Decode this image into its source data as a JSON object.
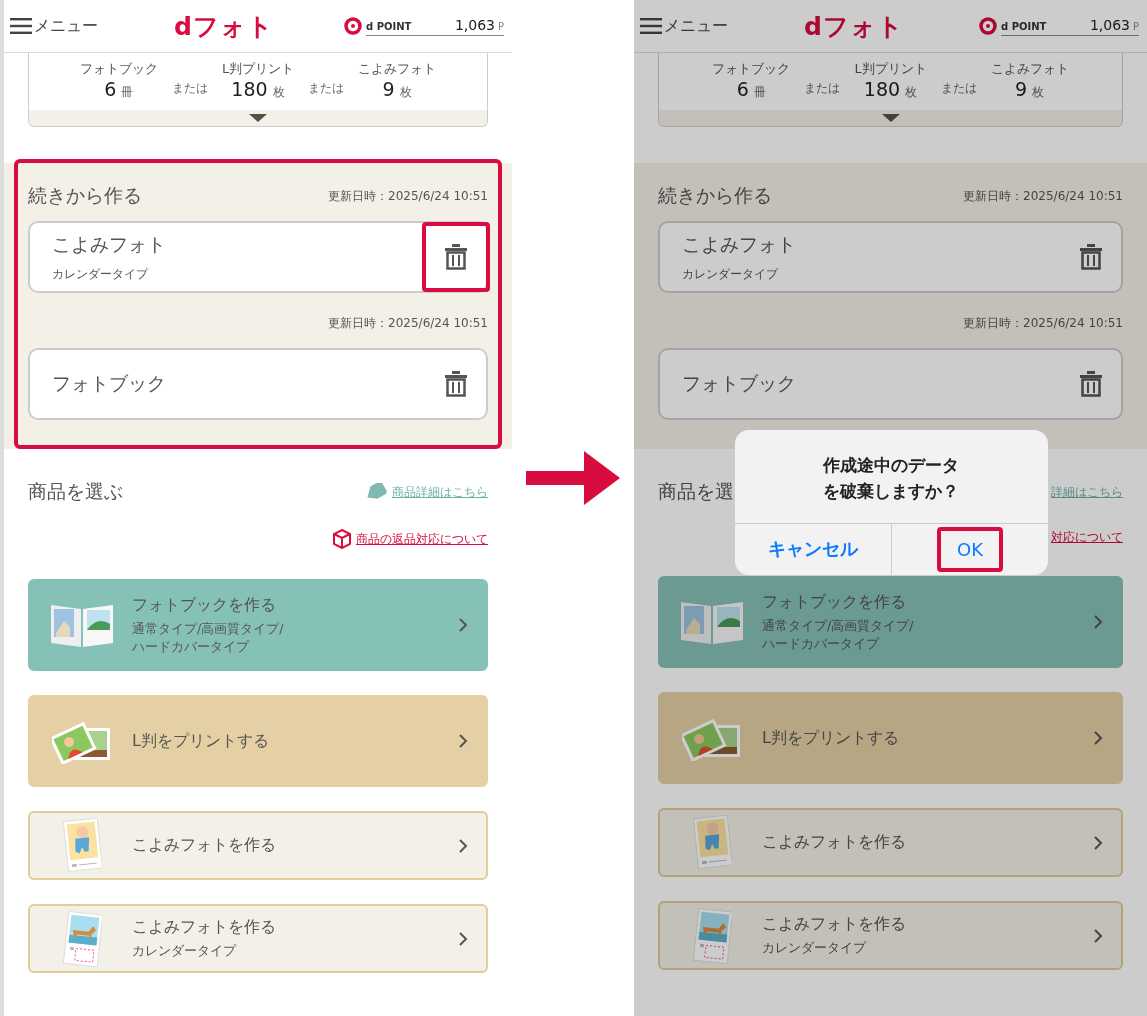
{
  "screens": [
    {
      "dimmed": false,
      "header": {
        "menu_label": "メニュー",
        "logo": "dフォト",
        "points_label": "d POINT",
        "points_value": "1,063",
        "points_unit": "P"
      },
      "summary": {
        "items": [
          {
            "label": "フォトブック",
            "count": "6",
            "unit": "冊"
          },
          {
            "label": "L判プリント",
            "count": "180",
            "unit": "枚"
          },
          {
            "label": "こよみフォト",
            "count": "9",
            "unit": "枚"
          }
        ],
        "connectors": [
          "または",
          "または"
        ]
      },
      "resume": {
        "title": "続きから作る",
        "updated": "更新日時：2025/6/24 10:51",
        "highlighted": true,
        "entries": [
          {
            "name": "こよみフォト",
            "subtitle": "カレンダータイプ",
            "delete_highlighted": true
          },
          {
            "updated": "更新日時：2025/6/24 10:51",
            "name": "フォトブック",
            "delete_highlighted": false
          }
        ]
      },
      "products": {
        "title": "商品を選ぶ",
        "detail_link": "商品詳細はこちら",
        "detail_icon": true,
        "returns_link": "商品の返品対応について",
        "returns_icon": true,
        "cards": [
          {
            "kind": "teal",
            "title": "フォトブックを作る",
            "subtitle_lines": [
              "通常タイプ/高画質タイプ/",
              "ハードカバータイプ"
            ]
          },
          {
            "kind": "tan",
            "title": "L判をプリントする"
          },
          {
            "kind": "cream",
            "title": "こよみフォトを作る"
          },
          {
            "kind": "cream",
            "title": "こよみフォトを作る",
            "subtitle_lines": [
              "カレンダータイプ"
            ]
          }
        ]
      }
    },
    {
      "dimmed": true,
      "header": {
        "menu_label": "メニュー",
        "logo": "dフォト",
        "points_label": "d POINT",
        "points_value": "1,063",
        "points_unit": "P"
      },
      "summary": {
        "items": [
          {
            "label": "フォトブック",
            "count": "6",
            "unit": "冊"
          },
          {
            "label": "L判プリント",
            "count": "180",
            "unit": "枚"
          },
          {
            "label": "こよみフォト",
            "count": "9",
            "unit": "枚"
          }
        ],
        "connectors": [
          "または",
          "または"
        ]
      },
      "resume": {
        "title": "続きから作る",
        "updated": "更新日時：2025/6/24 10:51",
        "highlighted": false,
        "entries": [
          {
            "name": "こよみフォト",
            "subtitle": "カレンダータイプ",
            "delete_highlighted": false
          },
          {
            "updated": "更新日時：2025/6/24 10:51",
            "name": "フォトブック",
            "delete_highlighted": false
          }
        ]
      },
      "products": {
        "title": "商品を選",
        "detail_link": "詳細はこちら",
        "detail_icon": false,
        "returns_link": "対応について",
        "returns_icon": false,
        "cards": [
          {
            "kind": "teal",
            "title": "フォトブックを作る",
            "subtitle_lines": [
              "通常タイプ/高画質タイプ/",
              "ハードカバータイプ"
            ]
          },
          {
            "kind": "tan",
            "title": "L判をプリントする"
          },
          {
            "kind": "cream",
            "title": "こよみフォトを作る"
          },
          {
            "kind": "cream",
            "title": "こよみフォトを作る",
            "subtitle_lines": [
              "カレンダータイプ"
            ]
          }
        ]
      },
      "dialog": {
        "message": "作成途中のデータを破棄しますか？",
        "buttons": [
          {
            "label": "キャンセル",
            "highlighted": false
          },
          {
            "label": "OK",
            "highlighted": true
          }
        ]
      }
    }
  ]
}
